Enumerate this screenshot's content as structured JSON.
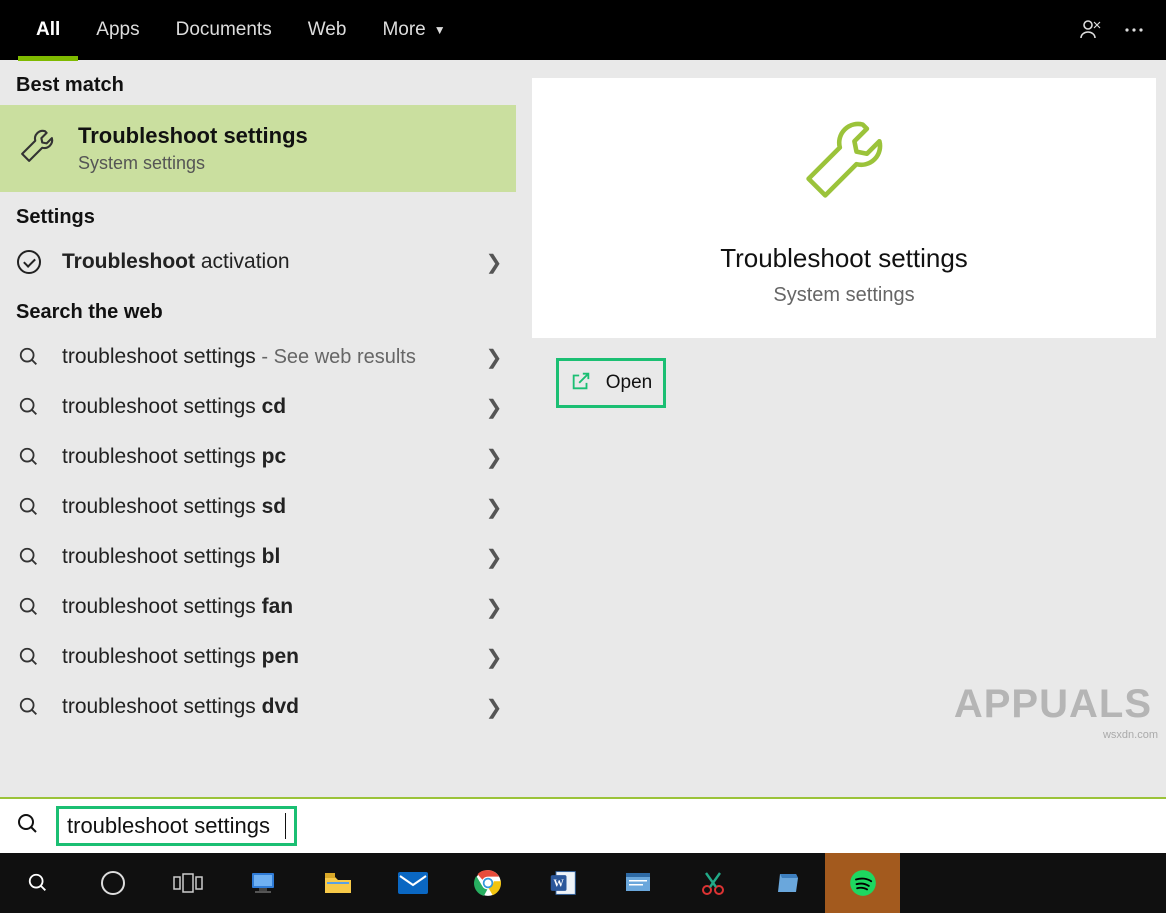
{
  "tabs": {
    "all": "All",
    "apps": "Apps",
    "documents": "Documents",
    "web": "Web",
    "more": "More"
  },
  "sections": {
    "best": "Best match",
    "settings": "Settings",
    "web": "Search the web"
  },
  "best": {
    "title": "Troubleshoot settings",
    "sub": "System settings"
  },
  "settings_rows": [
    {
      "prefix": "Troubleshoot",
      "suffix": " activation"
    }
  ],
  "web_first": {
    "text": "troubleshoot settings",
    "hint": " - See web results"
  },
  "web_rows": [
    {
      "base": "troubleshoot settings ",
      "bold": "cd"
    },
    {
      "base": "troubleshoot settings ",
      "bold": "pc"
    },
    {
      "base": "troubleshoot settings ",
      "bold": "sd"
    },
    {
      "base": "troubleshoot settings ",
      "bold": "bl"
    },
    {
      "base": "troubleshoot settings ",
      "bold": "fan"
    },
    {
      "base": "troubleshoot settings ",
      "bold": "pen"
    },
    {
      "base": "troubleshoot settings ",
      "bold": "dvd"
    }
  ],
  "detail": {
    "title": "Troubleshoot settings",
    "sub": "System settings",
    "open": "Open"
  },
  "search": {
    "value": "troubleshoot settings"
  },
  "watermark": {
    "big": "APPUALS",
    "small": "wsxdn.com"
  }
}
